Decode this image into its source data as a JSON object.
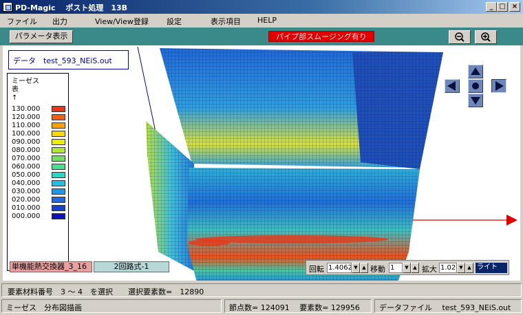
{
  "window": {
    "title": "PD-Magic　 ポスト処理　13B",
    "minimize": "_",
    "maximize": "□",
    "close": "×"
  },
  "menu": [
    "ファイル",
    "出力",
    "View/View登録",
    "設定",
    "表示項目",
    "HELP"
  ],
  "toolbar": {
    "param_button": "パラメータ表示",
    "smoothing_status": "パイプ部スムージング有り",
    "zoom_out_icon": "zoom-out-icon",
    "zoom_in_icon": "zoom-in-icon"
  },
  "viewport": {
    "data_label": "データ　test_593_NEiS.out",
    "legend": {
      "title_line1": "ミーゼス",
      "title_line2": "表",
      "arrow": "↑",
      "entries": [
        {
          "value": "130.000",
          "color": "#e83818"
        },
        {
          "value": "120.000",
          "color": "#f06010"
        },
        {
          "value": "110.000",
          "color": "#f8a000"
        },
        {
          "value": "100.000",
          "color": "#f8d800"
        },
        {
          "value": "090.000",
          "color": "#e8f000"
        },
        {
          "value": "080.000",
          "color": "#b0e838"
        },
        {
          "value": "070.000",
          "color": "#70e060"
        },
        {
          "value": "060.000",
          "color": "#48e090"
        },
        {
          "value": "050.000",
          "color": "#28d8c0"
        },
        {
          "value": "040.000",
          "color": "#20c0e0"
        },
        {
          "value": "030.000",
          "color": "#2098e8"
        },
        {
          "value": "020.000",
          "color": "#2068e0"
        },
        {
          "value": "010.000",
          "color": "#1840d0"
        },
        {
          "value": "000.000",
          "color": "#1010c0"
        }
      ]
    },
    "tabs": [
      "単機能熱交換器_3_16",
      "2回路式-1"
    ],
    "controls": {
      "rotate_label": "回転",
      "rotate_value": "1.4062",
      "move_label": "移動",
      "move_value": "1",
      "zoom_label": "拡大",
      "zoom_value": "1.02",
      "light_button": "ライト"
    }
  },
  "status": {
    "line1": "要素材料番号　3 ～ 4　を選択　　選択要素数=　12890",
    "mode": "ミーゼス　分布図描画",
    "nodes": "節点数= 124091　 要素数= 129956",
    "file": "データファイル　 test_593_NEiS.out"
  }
}
